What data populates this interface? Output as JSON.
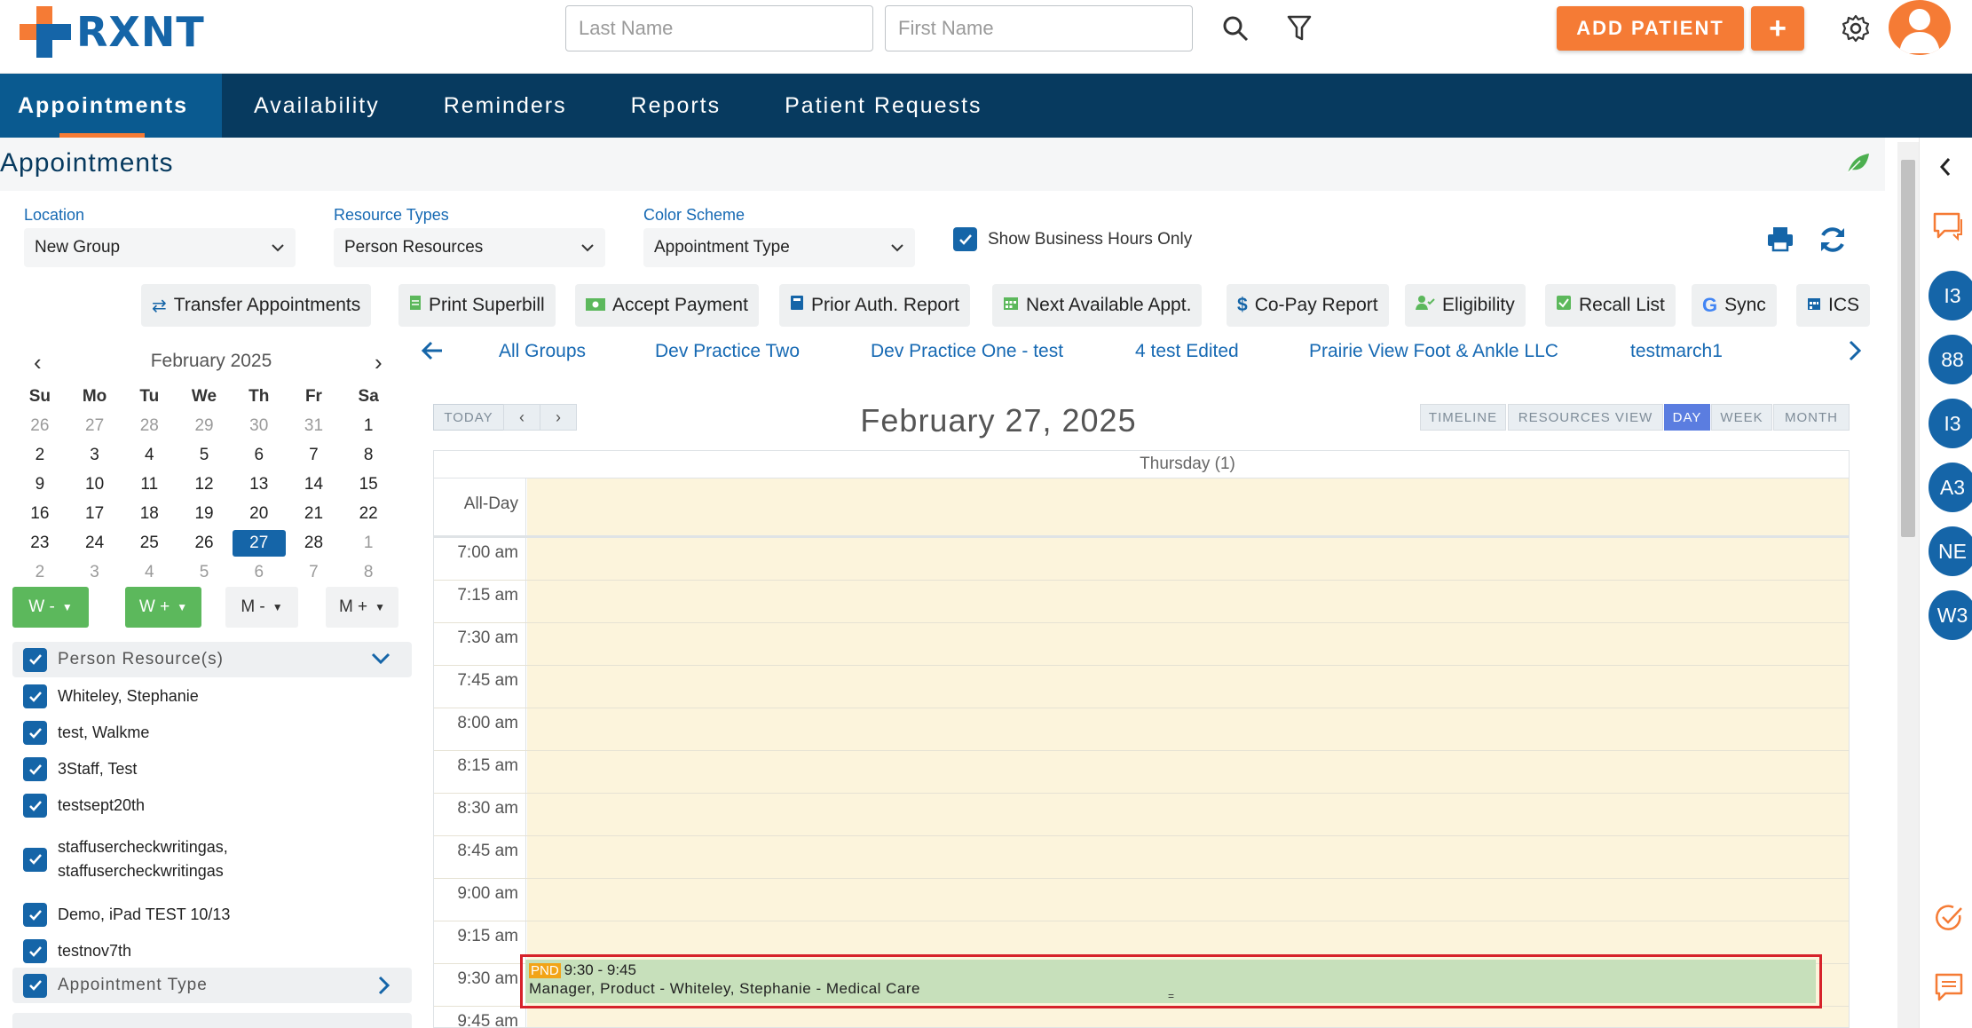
{
  "header": {
    "logo_text": "RXNT",
    "last_name_placeholder": "Last Name",
    "first_name_placeholder": "First Name",
    "add_patient_label": "ADD PATIENT",
    "add_plus_label": "+"
  },
  "nav": {
    "items": [
      {
        "label": "Appointments"
      },
      {
        "label": "Availability"
      },
      {
        "label": "Reminders"
      },
      {
        "label": "Reports"
      },
      {
        "label": "Patient Requests"
      }
    ]
  },
  "page": {
    "title": "Appointments"
  },
  "filters": {
    "location_label": "Location",
    "location_value": "New Group",
    "resource_types_label": "Resource Types",
    "resource_types_value": "Person Resources",
    "color_scheme_label": "Color Scheme",
    "color_scheme_value": "Appointment Type",
    "business_hours_label": "Show Business Hours Only"
  },
  "actions": [
    {
      "label": "Transfer Appointments"
    },
    {
      "label": "Print Superbill"
    },
    {
      "label": "Accept Payment"
    },
    {
      "label": "Prior Auth. Report"
    },
    {
      "label": "Next Available Appt."
    },
    {
      "label": "Co-Pay Report"
    },
    {
      "label": "Eligibility"
    },
    {
      "label": "Recall List"
    },
    {
      "label": "Sync"
    },
    {
      "label": "ICS"
    }
  ],
  "mini_calendar": {
    "month": "February 2025",
    "weekdays": [
      "Su",
      "Mo",
      "Tu",
      "We",
      "Th",
      "Fr",
      "Sa"
    ],
    "weeks": [
      [
        "26",
        "27",
        "28",
        "29",
        "30",
        "31",
        "1"
      ],
      [
        "2",
        "3",
        "4",
        "5",
        "6",
        "7",
        "8"
      ],
      [
        "9",
        "10",
        "11",
        "12",
        "13",
        "14",
        "15"
      ],
      [
        "16",
        "17",
        "18",
        "19",
        "20",
        "21",
        "22"
      ],
      [
        "23",
        "24",
        "25",
        "26",
        "27",
        "28",
        "1"
      ],
      [
        "2",
        "3",
        "4",
        "5",
        "6",
        "7",
        "8"
      ]
    ],
    "selected": "27"
  },
  "jump_buttons": [
    {
      "label": "W -"
    },
    {
      "label": "W +"
    },
    {
      "label": "M -"
    },
    {
      "label": "M +"
    }
  ],
  "resources": {
    "person_header": "Person Resource(s)",
    "items": [
      {
        "label": "Whiteley, Stephanie"
      },
      {
        "label": "test, Walkme"
      },
      {
        "label": "3Staff, Test"
      },
      {
        "label": "testsept20th"
      },
      {
        "label": "staffusercheckwritingas, staffusercheckwritingas"
      },
      {
        "label": "Demo, iPad TEST 10/13"
      },
      {
        "label": "testnov7th"
      }
    ],
    "appointment_type_header": "Appointment Type"
  },
  "groups": {
    "tabs": [
      {
        "label": "All Groups"
      },
      {
        "label": "Dev Practice Two"
      },
      {
        "label": "Dev Practice One - test"
      },
      {
        "label": "4 test Edited"
      },
      {
        "label": "Prairie View Foot & Ankle LLC"
      },
      {
        "label": "testmarch1"
      }
    ]
  },
  "calendar": {
    "today_label": "TODAY",
    "date_title": "February 27, 2025",
    "views": [
      {
        "label": "TIMELINE"
      },
      {
        "label": "RESOURCES VIEW"
      },
      {
        "label": "DAY"
      },
      {
        "label": "WEEK"
      },
      {
        "label": "MONTH"
      }
    ],
    "active_view": "DAY",
    "day_header": "Thursday (1)",
    "all_day_label": "All-Day",
    "times": [
      "7:00 am",
      "7:15 am",
      "7:30 am",
      "7:45 am",
      "8:00 am",
      "8:15 am",
      "8:30 am",
      "8:45 am",
      "9:00 am",
      "9:15 am",
      "9:30 am",
      "9:45 am"
    ],
    "appointment": {
      "status": "PND",
      "time": "9:30 - 9:45",
      "details": "Manager, Product - Whiteley, Stephanie - Medical Care",
      "handle": "="
    }
  },
  "rail": {
    "circles": [
      "I3",
      "88",
      "I3",
      "A3",
      "NE",
      "W3"
    ]
  },
  "colors": {
    "brand_blue": "#1565a8",
    "nav_bg": "#073a5f",
    "accent_orange": "#f57b35",
    "business_hours_bg": "#fcf4dc",
    "appointment_bg": "#c7e0bb",
    "highlight_red": "#d6222b"
  }
}
